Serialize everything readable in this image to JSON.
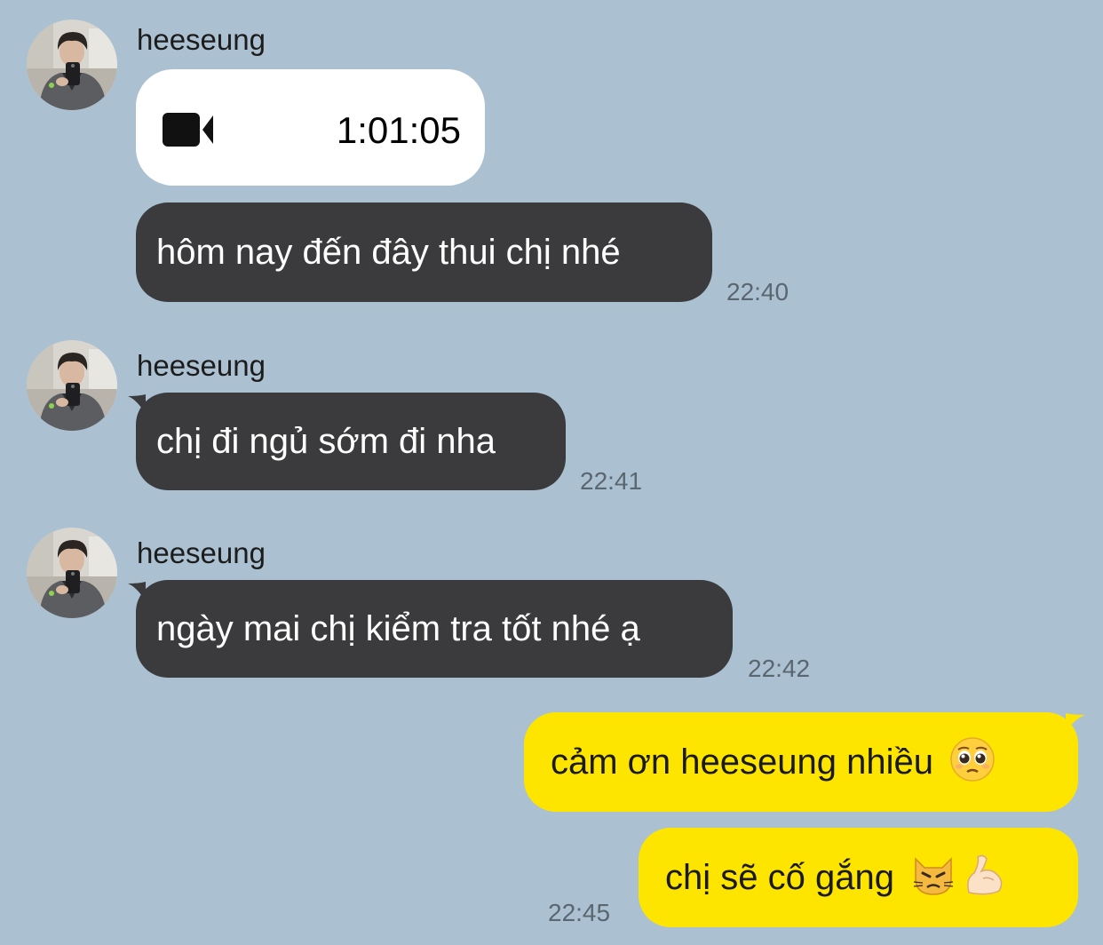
{
  "colors": {
    "background": "#abc1d1",
    "received_bubble": "#3b3b3d",
    "sent_bubble": "#fee500",
    "call_bubble": "#ffffff",
    "timestamp": "#5a6670"
  },
  "groups": [
    {
      "sender": "heeseung",
      "messages": [
        {
          "type": "video-call",
          "icon": "video-camera-icon",
          "duration": "1:01:05"
        },
        {
          "type": "text",
          "text": "hôm nay đến đây thui chị nhé",
          "time": "22:40"
        }
      ]
    },
    {
      "sender": "heeseung",
      "messages": [
        {
          "type": "text",
          "text": "chị đi ngủ sớm đi nha",
          "time": "22:41"
        }
      ]
    },
    {
      "sender": "heeseung",
      "messages": [
        {
          "type": "text",
          "text": "ngày mai chị kiểm tra tốt nhé ạ",
          "time": "22:42"
        }
      ]
    }
  ],
  "sent": [
    {
      "text": "cảm ơn heeseung nhiều",
      "emojis": [
        "pleading-face-emoji"
      ]
    },
    {
      "text": "chị sẽ cố gắng",
      "emojis": [
        "pouting-cat-emoji",
        "flexed-biceps-emoji"
      ],
      "time": "22:45"
    }
  ]
}
